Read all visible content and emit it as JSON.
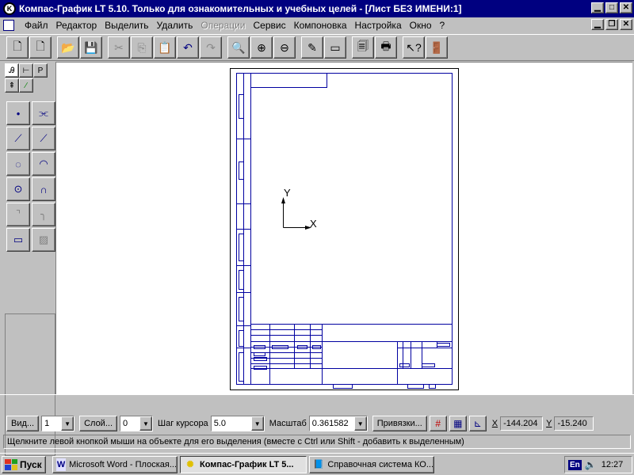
{
  "window": {
    "title": "Компас-График LT 5.10. Только для ознакомительных и учебных целей - [Лист БЕЗ ИМЕНИ:1]",
    "app_icon_letter": "K"
  },
  "menu": {
    "items": [
      {
        "label": "Файл",
        "disabled": false
      },
      {
        "label": "Редактор",
        "disabled": false
      },
      {
        "label": "Выделить",
        "disabled": false
      },
      {
        "label": "Удалить",
        "disabled": false
      },
      {
        "label": "Операции",
        "disabled": true
      },
      {
        "label": "Сервис",
        "disabled": false
      },
      {
        "label": "Компоновка",
        "disabled": false
      },
      {
        "label": "Настройка",
        "disabled": false
      },
      {
        "label": "Окно",
        "disabled": false
      },
      {
        "label": "?",
        "disabled": false
      }
    ]
  },
  "left_tabs": [
    "Ꭿ",
    "⊢",
    "P",
    "⇞",
    "∕"
  ],
  "drawing": {
    "axis_y_label": "Y",
    "axis_x_label": "X"
  },
  "params": {
    "view_button": "Вид...",
    "view_value": "1",
    "layer_button": "Слой...",
    "layer_value": "0",
    "step_label": "Шаг курсора",
    "step_value": "5.0",
    "scale_label": "Масштаб",
    "scale_value": "0.361582",
    "snap_button": "Привязки...",
    "x_label": "X",
    "x_value": "-144.204",
    "y_label": "Y",
    "y_value": "-15.240"
  },
  "hint": "Щелкните левой кнопкой мыши на объекте для его выделения (вместе с Ctrl или Shift - добавить к выделенным)",
  "taskbar": {
    "start_label": "Пуск",
    "tasks": [
      {
        "label": "Microsoft Word - Плоская...",
        "active": false
      },
      {
        "label": "Компас-График LT 5...",
        "active": true
      },
      {
        "label": "Справочная система КО...",
        "active": false
      }
    ],
    "lang": "En",
    "clock": "12:27"
  },
  "colors": {
    "titlebar": "#000080",
    "drawing_lines": "#0000a0",
    "canvas": "#ffffff"
  }
}
